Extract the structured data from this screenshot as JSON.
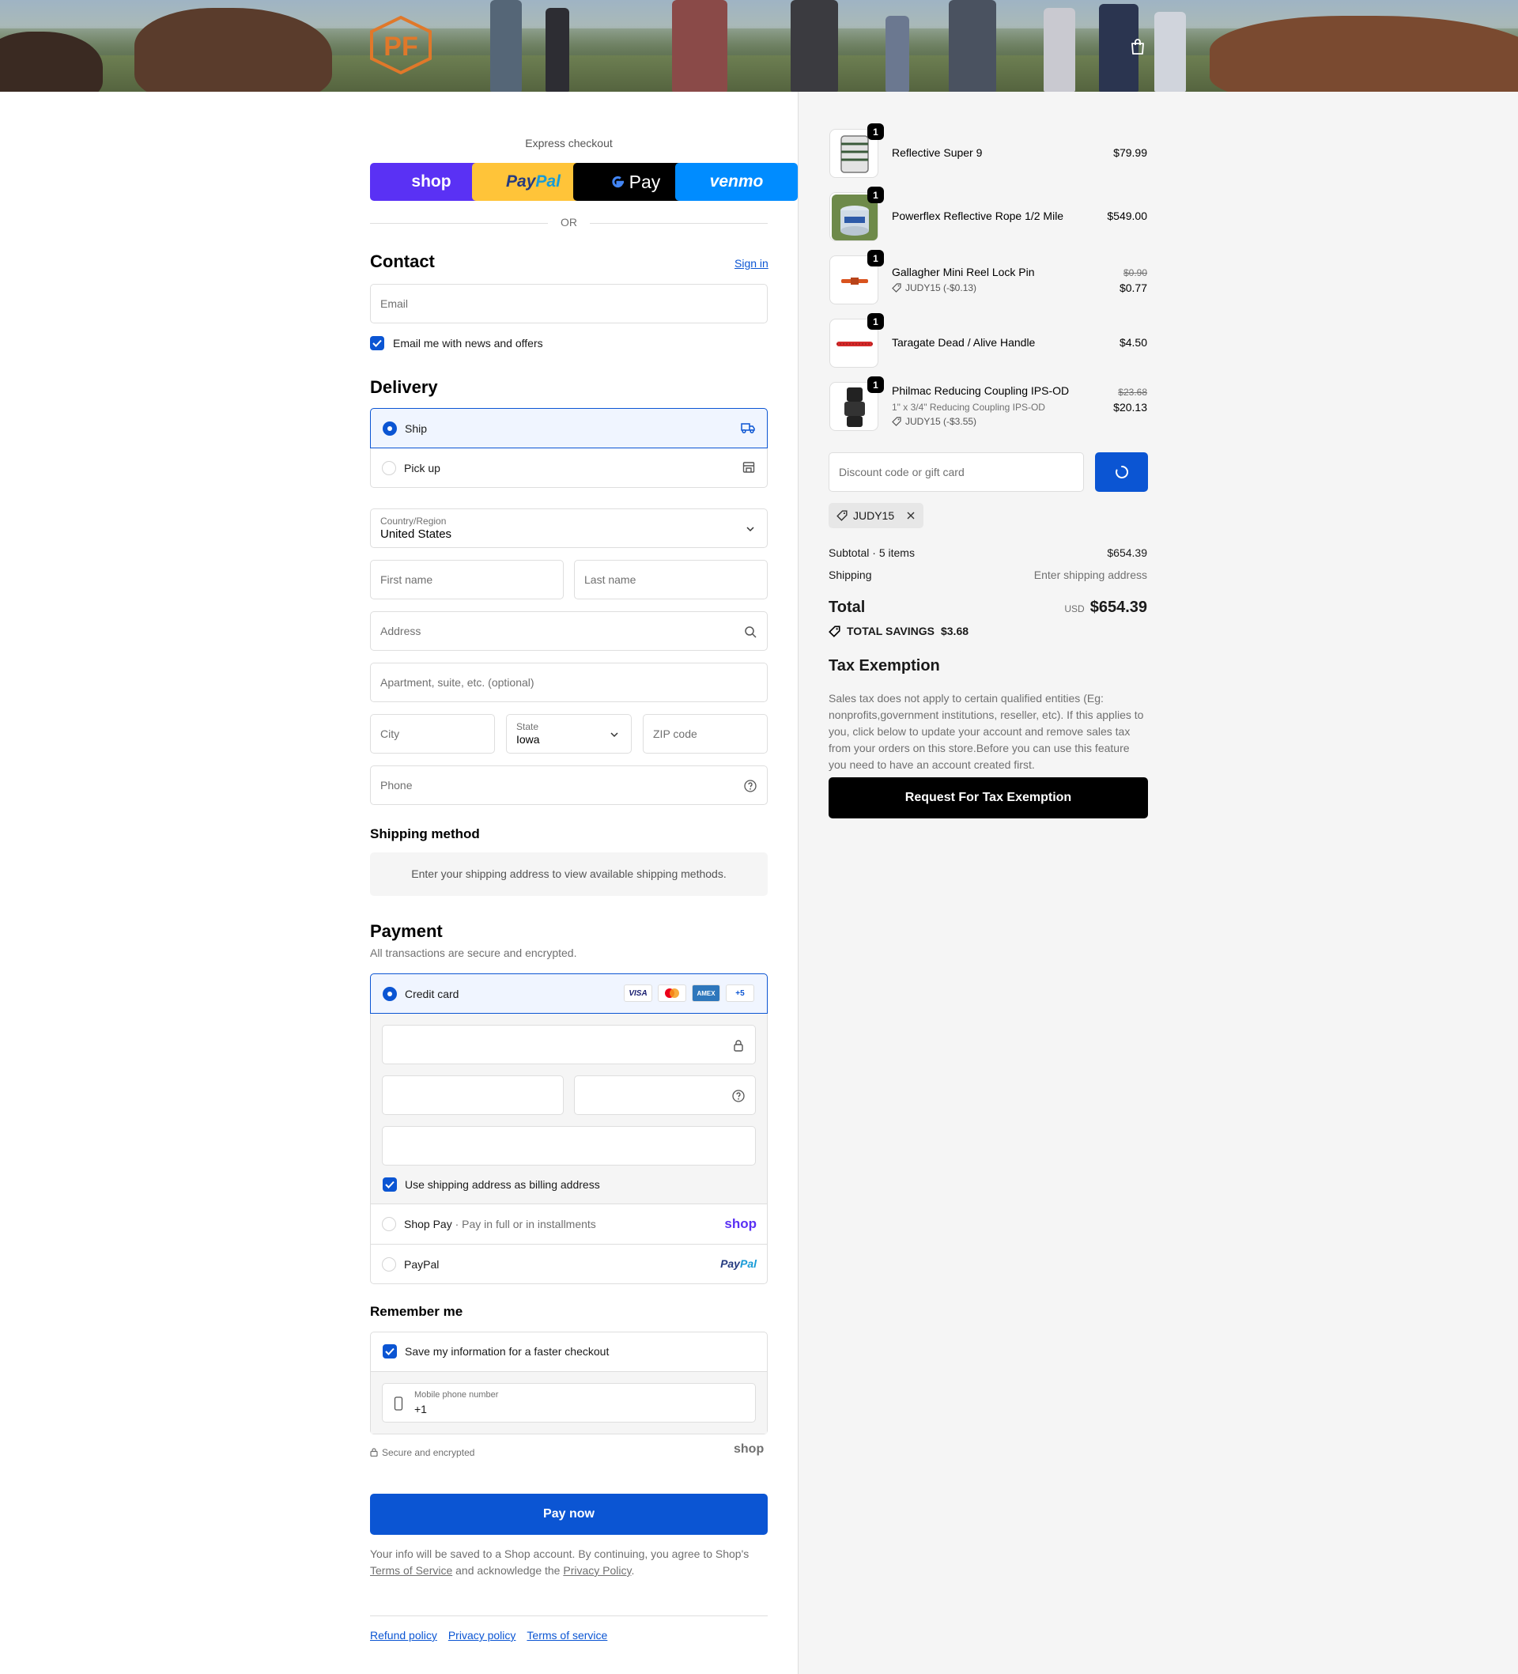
{
  "header": {
    "logo_text": "PF",
    "cart_icon": "shopping-bag-icon"
  },
  "express": {
    "title": "Express checkout",
    "buttons": {
      "shop": "shop",
      "paypal_pay": "Pay",
      "paypal_pal": "Pal",
      "gpay": "Pay",
      "venmo": "venmo"
    },
    "or": "OR"
  },
  "contact": {
    "title": "Contact",
    "sign_in": "Sign in",
    "email_placeholder": "Email",
    "news_label": "Email me with news and offers"
  },
  "delivery": {
    "title": "Delivery",
    "ship_label": "Ship",
    "pickup_label": "Pick up",
    "country_label": "Country/Region",
    "country_value": "United States",
    "first_name_placeholder": "First name",
    "last_name_placeholder": "Last name",
    "address_placeholder": "Address",
    "apartment_placeholder": "Apartment, suite, etc. (optional)",
    "city_placeholder": "City",
    "state_label": "State",
    "state_value": "Iowa",
    "zip_placeholder": "ZIP code",
    "phone_placeholder": "Phone"
  },
  "shipping_method": {
    "title": "Shipping method",
    "notice": "Enter your shipping address to view available shipping methods."
  },
  "payment": {
    "title": "Payment",
    "subtitle": "All transactions are secure and encrypted.",
    "credit_card_label": "Credit card",
    "card_logos": {
      "visa": "VISA",
      "amex": "AMEX",
      "more": "+5"
    },
    "billing_label": "Use shipping address as billing address",
    "shop_pay_label": "Shop Pay",
    "shop_pay_sub": "Pay in full or in installments",
    "shop_pay_logo": "shop",
    "paypal_label": "PayPal",
    "paypal_logo_pay": "Pay",
    "paypal_logo_pal": "Pal"
  },
  "remember": {
    "title": "Remember me",
    "save_label": "Save my information for a faster checkout",
    "mobile_label": "Mobile phone number",
    "mobile_value": "+1",
    "secure_label": "Secure and encrypted",
    "shop_logo": "shop"
  },
  "pay_now": "Pay now",
  "legal": {
    "line1": "Your info will be saved to a Shop account. By continuing, you agree to Shop's",
    "terms": "Terms of Service",
    "and": "and acknowledge the",
    "privacy": "Privacy Policy",
    "period": "."
  },
  "footer": {
    "refund": "Refund policy",
    "privacy": "Privacy policy",
    "terms": "Terms of service"
  },
  "cart": {
    "items": [
      {
        "name": "Reflective Super 9",
        "qty": "1",
        "price": "$79.99"
      },
      {
        "name": "Powerflex Reflective Rope 1/2 Mile",
        "qty": "1",
        "price": "$549.00"
      },
      {
        "name": "Gallagher Mini Reel Lock Pin",
        "qty": "1",
        "old_price": "$0.90",
        "price": "$0.77",
        "discount": "JUDY15 (-$0.13)"
      },
      {
        "name": "Taragate Dead / Alive Handle",
        "qty": "1",
        "price": "$4.50"
      },
      {
        "name": "Philmac Reducing Coupling IPS-OD",
        "qty": "1",
        "variant": "1\" x 3/4\" Reducing Coupling IPS-OD",
        "old_price": "$23.68",
        "price": "$20.13",
        "discount": "JUDY15 (-$3.55)"
      }
    ],
    "discount_placeholder": "Discount code or gift card",
    "applied_code": "JUDY15",
    "subtotal_label": "Subtotal · 5 items",
    "subtotal_value": "$654.39",
    "shipping_label": "Shipping",
    "shipping_value": "Enter shipping address",
    "total_label": "Total",
    "total_currency": "USD",
    "total_value": "$654.39",
    "savings_label": "TOTAL SAVINGS",
    "savings_value": "$3.68"
  },
  "tax": {
    "title": "Tax Exemption",
    "body": "Sales tax does not apply to certain qualified entities (Eg: nonprofits,government institutions, reseller, etc). If this applies to you, click below to update your account and remove sales tax from your orders on this store.Before you can use this feature you need to have an account created first.",
    "button": "Request For Tax Exemption"
  },
  "colors": {
    "accent": "#0b55d3",
    "shop_purple": "#5a31f4",
    "paypal_yellow": "#ffc439",
    "venmo_blue": "#008cff",
    "panel_bg": "#f5f5f5"
  }
}
